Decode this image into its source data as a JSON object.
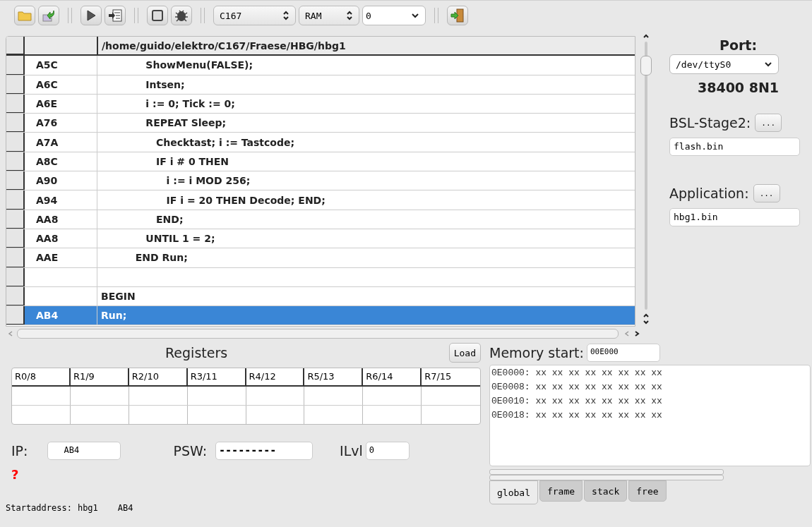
{
  "toolbar": {
    "target": "C167",
    "memory": "RAM",
    "bank": "0"
  },
  "code": {
    "header": "/home/guido/elektro/C167/Fraese/HBG/hbg1",
    "rows": [
      {
        "addr": "A5C",
        "text": "             ShowMenu(FALSE);",
        "selected": false
      },
      {
        "addr": "A6C",
        "text": "             Intsen;",
        "selected": false
      },
      {
        "addr": "A6E",
        "text": "             i := 0; Tick := 0;",
        "selected": false
      },
      {
        "addr": "A76",
        "text": "             REPEAT Sleep;",
        "selected": false
      },
      {
        "addr": "A7A",
        "text": "                Checktast; i := Tastcode;",
        "selected": false
      },
      {
        "addr": "A8C",
        "text": "                IF i # 0 THEN",
        "selected": false
      },
      {
        "addr": "A90",
        "text": "                   i := i MOD 256;",
        "selected": false
      },
      {
        "addr": "A94",
        "text": "                   IF i = 20 THEN Decode; END;",
        "selected": false
      },
      {
        "addr": "AA8",
        "text": "                END;",
        "selected": false
      },
      {
        "addr": "AA8",
        "text": "             UNTIL 1 = 2;",
        "selected": false
      },
      {
        "addr": "AAE",
        "text": "          END Run;",
        "selected": false
      },
      {
        "addr": "",
        "text": "",
        "selected": false
      },
      {
        "addr": "",
        "text": "BEGIN",
        "selected": false
      },
      {
        "addr": "AB4",
        "text": "Run;",
        "selected": true
      }
    ]
  },
  "port": {
    "label": "Port:",
    "device": "/dev/ttyS0",
    "settings": "38400 8N1"
  },
  "bsl": {
    "label": "BSL-Stage2:",
    "button": "...",
    "file": "flash.bin"
  },
  "application": {
    "label": "Application:",
    "button": "...",
    "file": "hbg1.bin"
  },
  "registers": {
    "title": "Registers",
    "load": "Load",
    "columns": [
      "R0/8",
      "R1/9",
      "R2/10",
      "R3/11",
      "R4/12",
      "R5/13",
      "R6/14",
      "R7/15"
    ]
  },
  "ip": {
    "label": "IP:",
    "value": "AB4"
  },
  "psw": {
    "label": "PSW:",
    "value": "---------"
  },
  "ilvl": {
    "label": "ILvl",
    "value": "0"
  },
  "error_mark": "?",
  "status": {
    "label": "Startaddress:",
    "module": "hbg1",
    "address": "AB4"
  },
  "memory": {
    "label": "Memory start:",
    "start": "00E000",
    "lines": [
      "0E0000: xx xx xx xx xx xx xx xx",
      "0E0008: xx xx xx xx xx xx xx xx",
      "0E0010: xx xx xx xx xx xx xx xx",
      "0E0018: xx xx xx xx xx xx xx xx"
    ]
  },
  "tabs": [
    {
      "label": "global",
      "selected": true
    },
    {
      "label": "frame",
      "selected": false
    },
    {
      "label": "stack",
      "selected": false
    },
    {
      "label": "free",
      "selected": false
    }
  ]
}
